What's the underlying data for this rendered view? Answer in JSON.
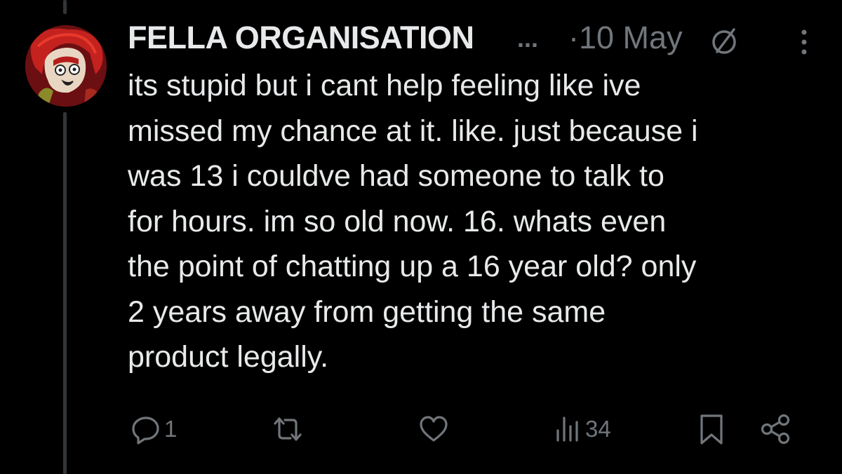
{
  "post": {
    "author": {
      "display_name": "FELLA ORGANISATION",
      "truncation": "...",
      "avatar_icon": "avatar-red-haired-cartoon"
    },
    "separator": "·",
    "date": "10 May",
    "status_icon": "blocked-circle-icon",
    "more_icon": "more-vertical-icon",
    "text": "its stupid but i cant help feeling like ive\nmissed my chance at it. like. just because i\nwas 13 i couldve had someone to talk to\nfor hours. im so old now. 16. whats even\nthe point of chatting up a 16 year old? only\n2 years away from getting the same\nproduct legally."
  },
  "actions": {
    "reply": {
      "icon": "reply-icon",
      "count": "1"
    },
    "retweet": {
      "icon": "retweet-icon",
      "count": ""
    },
    "like": {
      "icon": "heart-icon",
      "count": ""
    },
    "views": {
      "icon": "views-chart-icon",
      "count": "34"
    },
    "bookmark": {
      "icon": "bookmark-icon"
    },
    "share": {
      "icon": "share-icon"
    }
  },
  "colors": {
    "background": "#000000",
    "text_primary": "#e7e9ea",
    "text_secondary": "#71767b",
    "thread_line": "#333639"
  }
}
